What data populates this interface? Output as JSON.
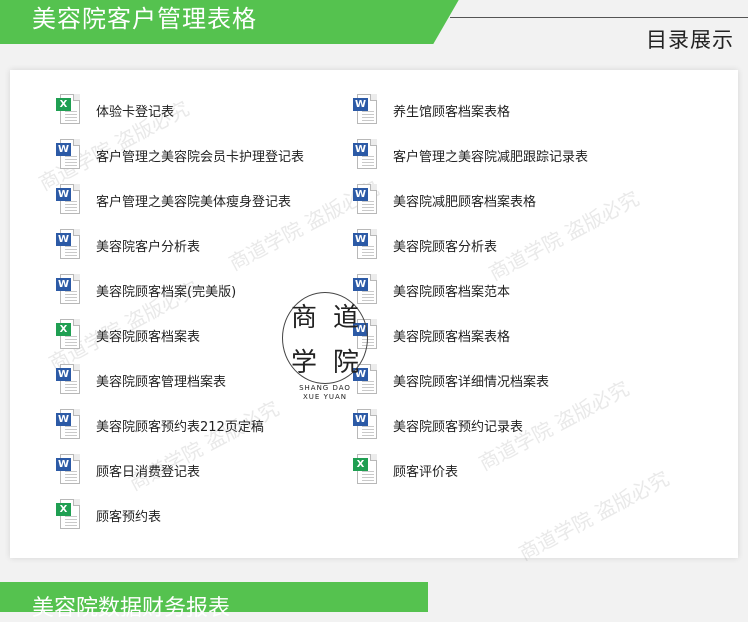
{
  "header": {
    "title": "美容院客户管理表格",
    "catalog_label": "目录展示"
  },
  "files": [
    {
      "label": "体验卡登记表",
      "type": "excel",
      "icon": "excel-file-icon"
    },
    {
      "label": "养生馆顾客档案表格",
      "type": "word",
      "icon": "word-file-icon"
    },
    {
      "label": "客户管理之美容院会员卡护理登记表",
      "type": "word",
      "icon": "word-file-icon"
    },
    {
      "label": "客户管理之美容院减肥跟踪记录表",
      "type": "word",
      "icon": "word-file-icon"
    },
    {
      "label": "客户管理之美容院美体瘦身登记表",
      "type": "word",
      "icon": "word-file-icon"
    },
    {
      "label": "美容院减肥顾客档案表格",
      "type": "word",
      "icon": "word-file-icon"
    },
    {
      "label": "美容院客户分析表",
      "type": "word",
      "icon": "word-file-icon"
    },
    {
      "label": "美容院顾客分析表",
      "type": "word",
      "icon": "word-file-icon"
    },
    {
      "label": "美容院顾客档案(完美版)",
      "type": "word",
      "icon": "word-file-icon"
    },
    {
      "label": "美容院顾客档案范本",
      "type": "word",
      "icon": "word-file-icon"
    },
    {
      "label": "美容院顾客档案表",
      "type": "excel",
      "icon": "excel-file-icon"
    },
    {
      "label": "美容院顾客档案表格",
      "type": "word",
      "icon": "word-file-icon"
    },
    {
      "label": "美容院顾客管理档案表",
      "type": "word",
      "icon": "word-file-icon"
    },
    {
      "label": "美容院顾客详细情况档案表",
      "type": "word",
      "icon": "word-file-icon"
    },
    {
      "label": "美容院顾客预约表212页定稿",
      "type": "word",
      "icon": "word-file-icon"
    },
    {
      "label": "美容院顾客预约记录表",
      "type": "word",
      "icon": "word-file-icon"
    },
    {
      "label": "顾客日消费登记表",
      "type": "word",
      "icon": "word-file-icon"
    },
    {
      "label": "顾客评价表",
      "type": "excel",
      "icon": "excel-file-icon"
    },
    {
      "label": "顾客预约表",
      "type": "excel",
      "icon": "excel-file-icon"
    }
  ],
  "logo": {
    "chars": [
      "商",
      "道",
      "学",
      "院"
    ],
    "sub_line1": "SHANG DAO",
    "sub_line2": "XUE YUAN"
  },
  "watermark_text": "商道学院 盗版必究",
  "bottom_banner": {
    "title": "美容院数据财务报表"
  },
  "colors": {
    "banner_green": "#55c24f",
    "excel_green": "#1f9f52",
    "word_blue": "#2c5aa6"
  }
}
